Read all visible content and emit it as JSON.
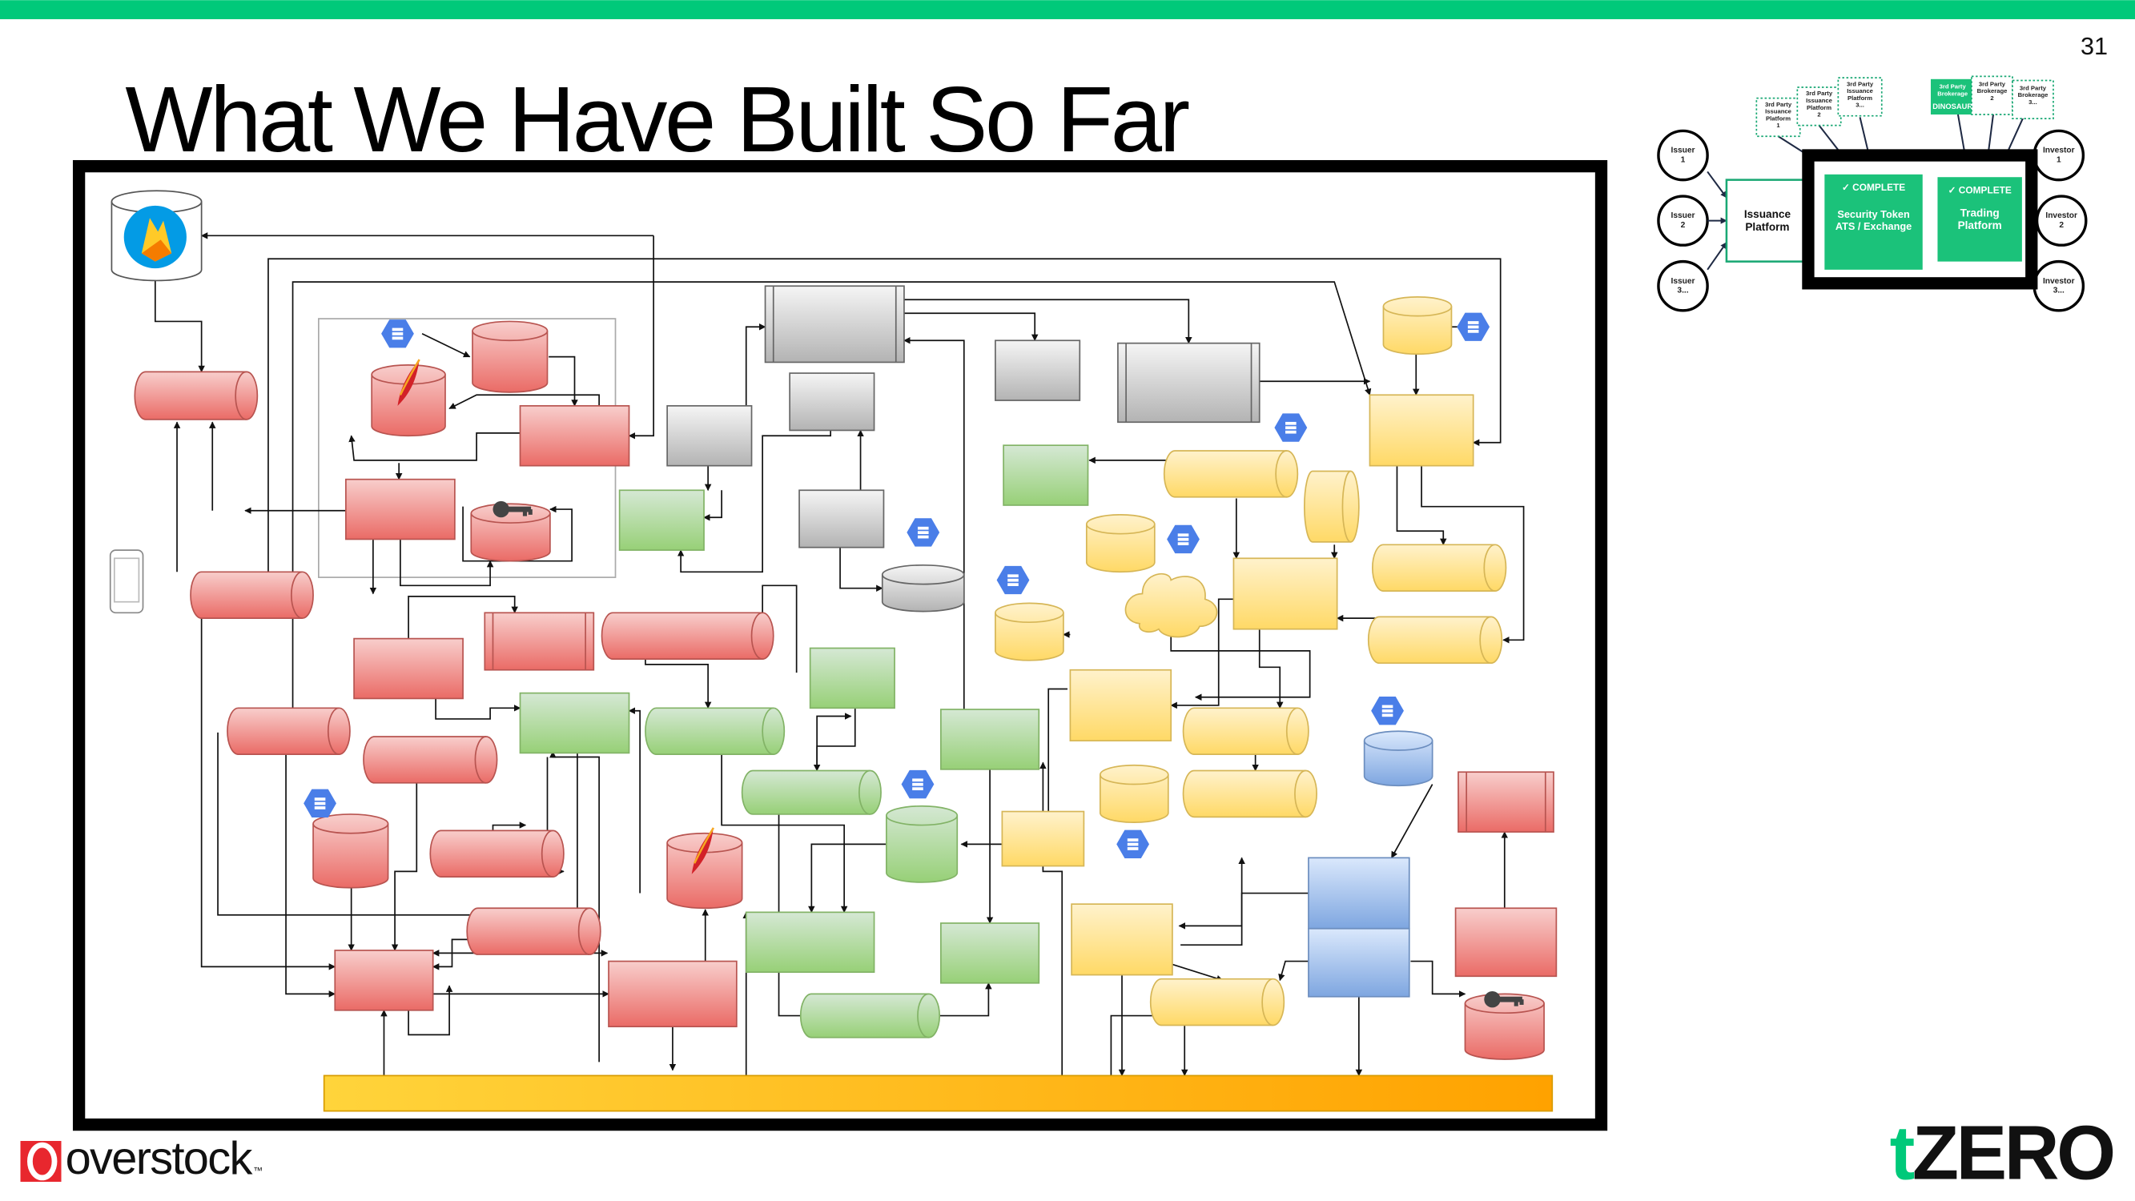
{
  "slide": {
    "title": "What We Have Built So Far",
    "page_number": "31",
    "accent_color": "#00c97a"
  },
  "architecture_diagram": {
    "colors": {
      "red": "#e06666",
      "grey": "#b3b3b3",
      "green": "#97d077",
      "yellow": "#ffd966",
      "blue": "#7ea6e0",
      "bus": "#ffb300"
    },
    "icons": [
      "firebase-icon",
      "mobile-phone-icon",
      "google-cloud-hexagon-icon",
      "apache-feather-icon",
      "key-icon",
      "cloud-icon"
    ]
  },
  "overview": {
    "issuers": [
      "Issuer\n1",
      "Issuer\n2",
      "Issuer\n3..."
    ],
    "investors": [
      "Investor\n1",
      "Investor\n2",
      "Investor\n3..."
    ],
    "issuance_platform": "Issuance Platform",
    "third_party_issuance": [
      "3rd Party Issuance Platform 1",
      "3rd Party Issuance Platform 2",
      "3rd Party Issuance Platform 3..."
    ],
    "third_party_brokerage": [
      "3rd Party Brokerage",
      "3rd Party Brokerage 2",
      "3rd Party Brokerage 3..."
    ],
    "dinosaur_label": "DINOSAUR",
    "ats": {
      "status": "✓ COMPLETE",
      "label": "Security Token ATS / Exchange"
    },
    "trading": {
      "status": "✓ COMPLETE",
      "label": "Trading Platform"
    }
  },
  "footer": {
    "left_logo": "overstock",
    "left_logo_tm": "™",
    "right_logo_t": "t",
    "right_logo_rest": "ZERO"
  }
}
